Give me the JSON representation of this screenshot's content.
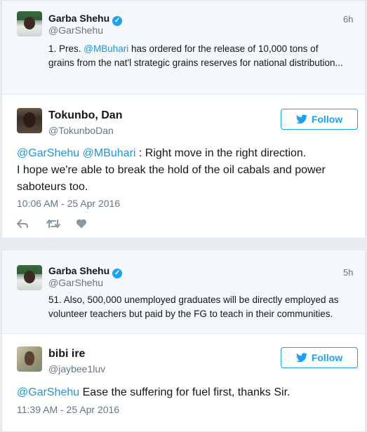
{
  "tweet1": {
    "quoted": {
      "name": "Garba Shehu",
      "handle": "@GarShehu",
      "time": "6h",
      "text_pre": "1. Pres. ",
      "mention": "@MBuhari",
      "text_post": " has ordered for the release of 10,000 tons of grains from the nat'l strategic grains reserves for national distribution..."
    },
    "reply": {
      "name": "Tokunbo, Dan",
      "handle": "@TokunboDan",
      "follow_label": "Follow",
      "mention1": "@GarShehu",
      "mention2": "@MBuhari",
      "text_line1": " : Right move in the right direction.",
      "text_line2": "I hope we're able to break the hold of the oil cabals and power",
      "text_line3": "saboteurs too.",
      "timestamp": "10:06 AM - 25 Apr 2016"
    }
  },
  "tweet2": {
    "quoted": {
      "name": "Garba Shehu",
      "handle": "@GarShehu",
      "time": "5h",
      "text": "51. Also, 500,000 unemployed graduates will be directly employed as volunteer teachers but paid by the FG to teach in their communities."
    },
    "reply": {
      "name": "bibi ire",
      "handle": "@jaybee1luv",
      "follow_label": "Follow",
      "mention": "@GarShehu",
      "text": " Ease the suffering for fuel first, thanks Sir.",
      "timestamp": "11:39 AM - 25 Apr 2016"
    }
  },
  "colors": {
    "accent": "#1da1f2",
    "mention": "#1b95e0",
    "secondary_text": "#657786",
    "background": "#e6ecf0"
  }
}
